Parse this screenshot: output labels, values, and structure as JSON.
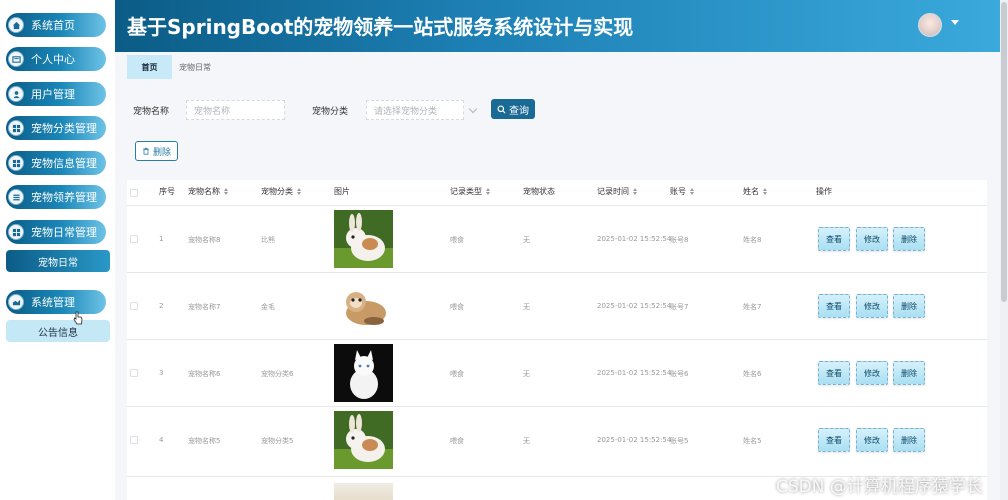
{
  "header": {
    "title": "基于SpringBoot的宠物领养一站式服务系统设计与实现"
  },
  "sidebar": {
    "items": [
      {
        "label": "系统首页",
        "icon": "home-icon"
      },
      {
        "label": "个人中心",
        "icon": "card-icon"
      },
      {
        "label": "用户管理",
        "icon": "user-icon"
      },
      {
        "label": "宠物分类管理",
        "icon": "grid-icon"
      },
      {
        "label": "宠物信息管理",
        "icon": "grid-icon"
      },
      {
        "label": "宠物领养管理",
        "icon": "list-icon"
      },
      {
        "label": "宠物日常管理",
        "icon": "grid-icon"
      }
    ],
    "active_sub": "宠物日常",
    "system": {
      "label": "系统管理",
      "icon": "system-icon"
    },
    "system_sub": "公告信息"
  },
  "tabs": [
    {
      "label": "首页"
    },
    {
      "label": "宠物日常"
    }
  ],
  "search": {
    "name_label": "宠物名称",
    "name_placeholder": "宠物名称",
    "category_label": "宠物分类",
    "category_placeholder": "请选择宠物分类",
    "query_label": "查询"
  },
  "toolbar": {
    "delete_label": "删除"
  },
  "table": {
    "headers": [
      "序号",
      "宠物名称",
      "宠物分类",
      "图片",
      "记录类型",
      "宠物状态",
      "记录时间",
      "账号",
      "姓名",
      "操作"
    ],
    "rows": [
      {
        "no": "1",
        "name": "宠物名称8",
        "category": "比熊",
        "type": "喂食",
        "status": "无",
        "time": "2025-01-02 15:52:54",
        "account": "账号8",
        "person": "姓名8",
        "picture": "bunny"
      },
      {
        "no": "2",
        "name": "宠物名称7",
        "category": "金毛",
        "type": "喂食",
        "status": "无",
        "time": "2025-01-02 15:52:54",
        "account": "账号7",
        "person": "姓名7",
        "picture": "ferret"
      },
      {
        "no": "3",
        "name": "宠物名称6",
        "category": "宠物分类6",
        "type": "喂食",
        "status": "无",
        "time": "2025-01-02 15:52:54",
        "account": "账号6",
        "person": "姓名6",
        "picture": "white-cat"
      },
      {
        "no": "4",
        "name": "宠物名称5",
        "category": "宠物分类5",
        "type": "喂食",
        "status": "无",
        "time": "2025-01-02 15:52:54",
        "account": "账号5",
        "person": "姓名5",
        "picture": "bunny"
      }
    ],
    "actions": {
      "view": "查看",
      "edit": "修改",
      "delete": "删除"
    }
  },
  "watermark": "CSDN @计算机程序猿学长"
}
